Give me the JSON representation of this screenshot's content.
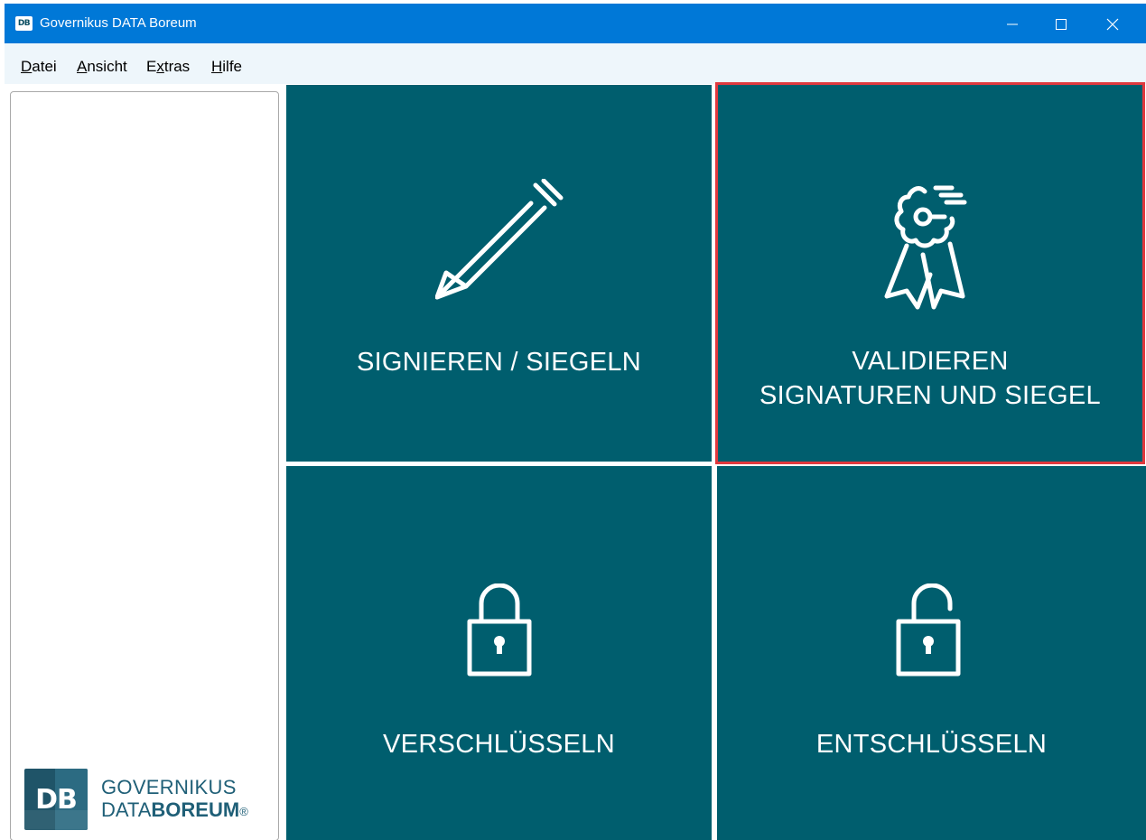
{
  "window": {
    "title": "Governikus DATA Boreum",
    "app_icon": "DB",
    "controls": [
      "minimize-icon",
      "maximize-icon",
      "close-icon"
    ]
  },
  "menu": {
    "items": [
      {
        "underline": "D",
        "rest": "atei"
      },
      {
        "underline": "A",
        "rest": "nsicht"
      },
      {
        "pre": "E",
        "underline": "x",
        "rest": "tras"
      },
      {
        "underline": "H",
        "rest": "ilfe"
      }
    ]
  },
  "branding": {
    "logo_letters": "DB",
    "line1": "GOVERNIKUS",
    "line2_prefix": "DATA",
    "line2_bold": "BOREUM",
    "registered": "®"
  },
  "tiles": {
    "sign": {
      "label": "SIGNIEREN / SIEGELN",
      "icon": "pencil-icon"
    },
    "validate": {
      "line1": "VALIDIEREN",
      "line2": "SIGNATUREN UND SIEGEL",
      "icon": "award-ribbon-icon",
      "selected": true
    },
    "encrypt": {
      "label": "VERSCHLÜSSELN",
      "icon": "lock-closed-icon"
    },
    "decrypt": {
      "label": "ENTSCHLÜSSELN",
      "icon": "lock-open-icon"
    }
  },
  "colors": {
    "titlebar": "#0078d7",
    "menubar": "#eef6fb",
    "tile": "#005e6e",
    "selection": "#e0393e",
    "brand": "#1f5f77"
  }
}
